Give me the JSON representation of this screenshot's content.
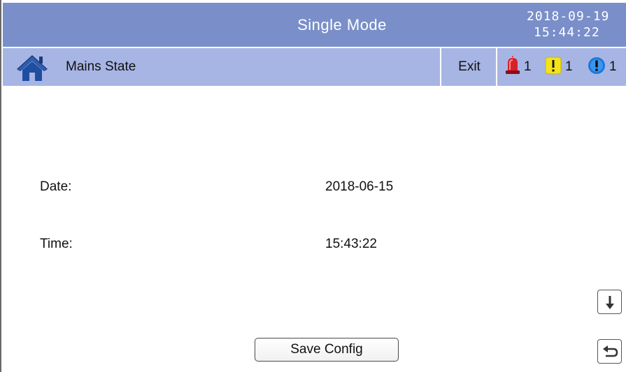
{
  "header": {
    "title": "Single Mode",
    "date": "2018-09-19",
    "time": "15:44:22"
  },
  "subheader": {
    "home_icon": "home-icon",
    "page_title": "Mains State",
    "exit_label": "Exit",
    "alarms": [
      {
        "icon": "red-alarm-beacon-icon",
        "count": "1"
      },
      {
        "icon": "yellow-warning-icon",
        "count": "1"
      },
      {
        "icon": "blue-info-icon",
        "count": "1"
      }
    ]
  },
  "fields": [
    {
      "label": "Date:",
      "value": "2018-06-15"
    },
    {
      "label": "Time:",
      "value": "15:43:22"
    }
  ],
  "footer": {
    "save_label": "Save Config",
    "scroll_down_icon": "arrow-down-icon",
    "back_icon": "back-arrow-icon"
  },
  "colors": {
    "titlebar": "#7a8fc9",
    "subbar": "#a7b5e4",
    "alarm_red": "#d8202a",
    "warning_yellow": "#f4e21c",
    "info_blue": "#1e78d6"
  }
}
